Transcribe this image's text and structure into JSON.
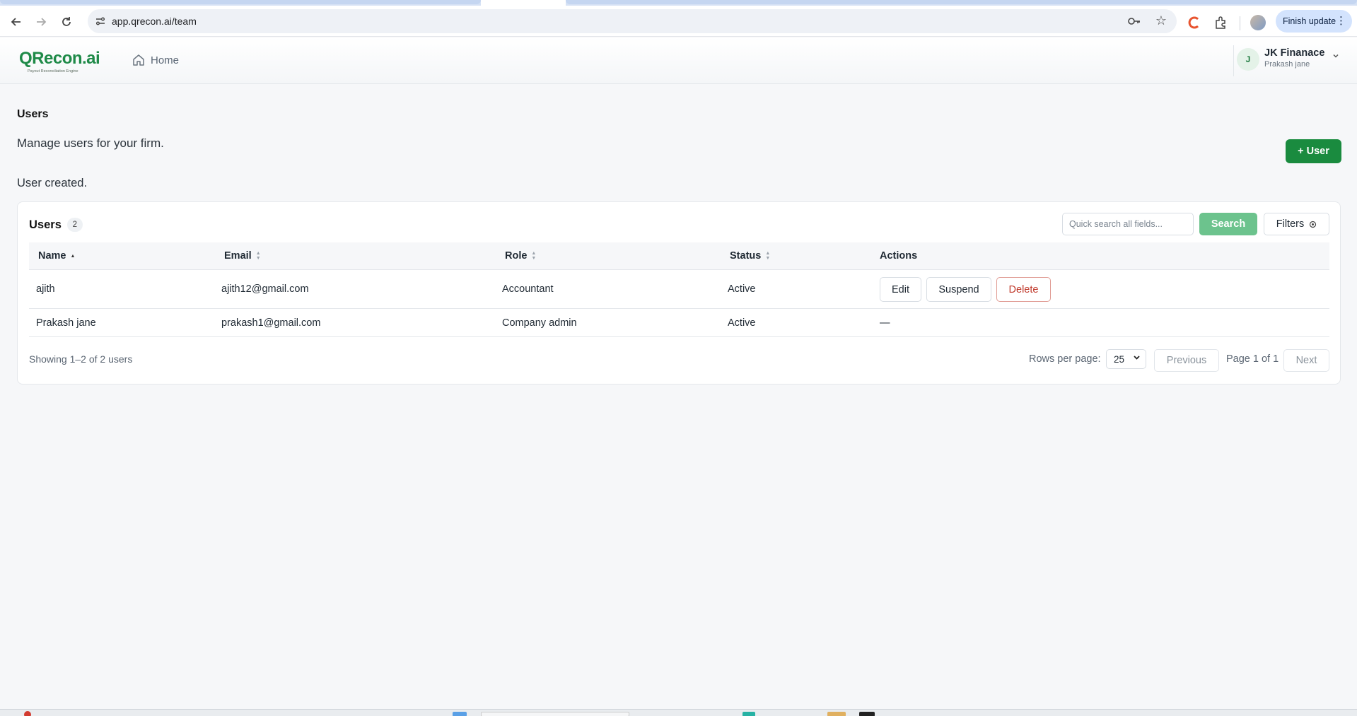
{
  "browser": {
    "url": "app.qrecon.ai/team",
    "finish_update_label": "Finish update"
  },
  "header": {
    "logo_text": "QRecon.ai",
    "logo_tagline": "Payout Reconciliation Engine",
    "home_label": "Home",
    "account": {
      "avatar_initial": "J",
      "company": "JK Finanace",
      "user": "Prakash jane"
    }
  },
  "page": {
    "title": "Users",
    "description": "Manage users for your firm.",
    "add_button": "+ User",
    "flash_message": "User created."
  },
  "users_card": {
    "title": "Users",
    "count": "2",
    "search_placeholder": "Quick search all fields...",
    "search_button": "Search",
    "filters_button": "Filters",
    "columns": [
      "Name",
      "Email",
      "Role",
      "Status",
      "Actions"
    ],
    "rows": [
      {
        "name": "ajith",
        "email": "ajith12@gmail.com",
        "role": "Accountant",
        "status": "Active",
        "actions": [
          "Edit",
          "Suspend",
          "Delete"
        ]
      },
      {
        "name": "Prakash jane",
        "email": "prakash1@gmail.com",
        "role": "Company admin",
        "status": "Active",
        "actions_placeholder": "—"
      }
    ],
    "showing_text": "Showing 1–2 of 2 users",
    "rows_per_page_label": "Rows per page:",
    "rows_per_page_value": "25",
    "previous_button": "Previous",
    "page_indicator": "Page 1 of 1",
    "next_button": "Next"
  },
  "colors": {
    "brand_green": "#1a8b3f",
    "search_button_green": "#6cc38d",
    "delete_red": "#c0392b"
  }
}
